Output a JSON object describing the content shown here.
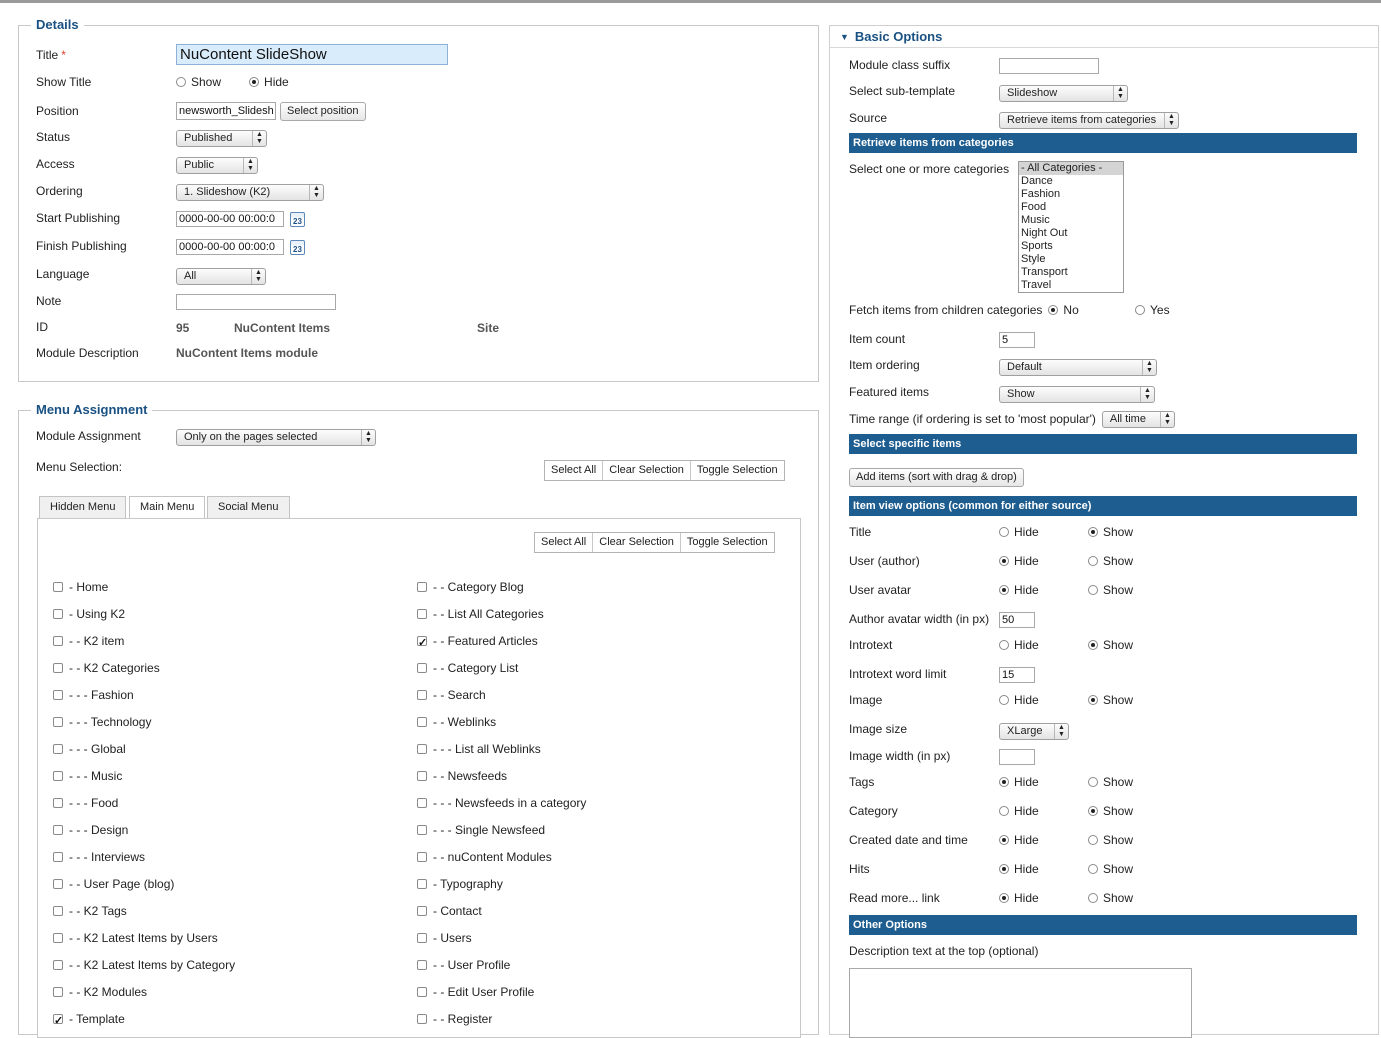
{
  "details": {
    "legend": "Details",
    "title_label": "Title",
    "title_required": "*",
    "title_value": "NuContent SlideShow",
    "show_title_label": "Show Title",
    "show_label": "Show",
    "hide_label": "Hide",
    "position_label": "Position",
    "position_value": "newsworth_Slideshc",
    "select_position": "Select position",
    "status_label": "Status",
    "status_value": "Published",
    "access_label": "Access",
    "access_value": "Public",
    "ordering_label": "Ordering",
    "ordering_value": "1. Slideshow (K2)",
    "start_label": "Start Publishing",
    "start_value": "0000-00-00 00:00:0",
    "finish_label": "Finish Publishing",
    "finish_value": "0000-00-00 00:00:0",
    "calendar_icon_text": "23",
    "language_label": "Language",
    "language_value": "All",
    "note_label": "Note",
    "note_value": "",
    "id_label": "ID",
    "id_value": "95",
    "id_module": "NuContent Items",
    "id_site": "Site",
    "desc_label": "Module Description",
    "desc_value": "NuContent Items module"
  },
  "menu": {
    "legend": "Menu Assignment",
    "assignment_label": "Module Assignment",
    "assignment_value": "Only on the pages selected",
    "selection_label": "Menu Selection:",
    "select_all": "Select All",
    "clear_selection": "Clear Selection",
    "toggle_selection": "Toggle Selection",
    "tabs": [
      "Hidden Menu",
      "Main Menu",
      "Social Menu"
    ],
    "left_items": [
      {
        "label": "- Home",
        "checked": false
      },
      {
        "label": "- Using K2",
        "checked": false
      },
      {
        "label": "- - K2 item",
        "checked": false
      },
      {
        "label": "- - K2 Categories",
        "checked": false
      },
      {
        "label": "- - - Fashion",
        "checked": false
      },
      {
        "label": "- - - Technology",
        "checked": false
      },
      {
        "label": "- - - Global",
        "checked": false
      },
      {
        "label": "- - - Music",
        "checked": false
      },
      {
        "label": "- - - Food",
        "checked": false
      },
      {
        "label": "- - - Design",
        "checked": false
      },
      {
        "label": "- - - Interviews",
        "checked": false
      },
      {
        "label": "- - User Page (blog)",
        "checked": false
      },
      {
        "label": "- - K2 Tags",
        "checked": false
      },
      {
        "label": "- - K2 Latest Items by Users",
        "checked": false
      },
      {
        "label": "- - K2 Latest Items by Category",
        "checked": false
      },
      {
        "label": "- - K2 Modules",
        "checked": false
      },
      {
        "label": "- Template",
        "checked": true
      }
    ],
    "right_items": [
      {
        "label": "- - Category Blog",
        "checked": false
      },
      {
        "label": "- - List All Categories",
        "checked": false
      },
      {
        "label": "- - Featured Articles",
        "checked": true
      },
      {
        "label": "- - Category List",
        "checked": false
      },
      {
        "label": "- - Search",
        "checked": false
      },
      {
        "label": "- - Weblinks",
        "checked": false
      },
      {
        "label": "- - - List all Weblinks",
        "checked": false
      },
      {
        "label": "- - Newsfeeds",
        "checked": false
      },
      {
        "label": "- - - Newsfeeds in a category",
        "checked": false
      },
      {
        "label": "- - - Single Newsfeed",
        "checked": false
      },
      {
        "label": "- - nuContent Modules",
        "checked": false
      },
      {
        "label": "- Typography",
        "checked": false
      },
      {
        "label": "- Contact",
        "checked": false
      },
      {
        "label": "- Users",
        "checked": false
      },
      {
        "label": "- - User Profile",
        "checked": false
      },
      {
        "label": "- - Edit User Profile",
        "checked": false
      },
      {
        "label": "- - Register",
        "checked": false
      }
    ]
  },
  "basic": {
    "title": "Basic Options",
    "suffix_label": "Module class suffix",
    "suffix_value": "",
    "subtemplate_label": "Select sub-template",
    "subtemplate_value": "Slideshow",
    "source_label": "Source",
    "source_value": "Retrieve items from categories",
    "bar_categories": "Retrieve items from categories",
    "categories_label": "Select one or more categories",
    "categories": [
      "- All Categories -",
      "Dance",
      "Fashion",
      "Food",
      "Music",
      "Night Out",
      "Sports",
      "Style",
      "Transport",
      "Travel"
    ],
    "children_label": "Fetch items from children categories",
    "no_label": "No",
    "yes_label": "Yes",
    "count_label": "Item count",
    "count_value": "5",
    "ordering_label": "Item ordering",
    "ordering_value": "Default",
    "featured_label": "Featured items",
    "featured_value": "Show",
    "timerange_label": "Time range (if ordering is set to 'most popular')",
    "timerange_value": "All time",
    "bar_specific": "Select specific items",
    "add_items": "Add items (sort with drag & drop)",
    "bar_view": "Item view options (common for either source)",
    "hide": "Hide",
    "show": "Show",
    "view_rows": [
      {
        "label": "Title",
        "selected": "show"
      },
      {
        "label": "User (author)",
        "selected": "hide"
      },
      {
        "label": "User avatar",
        "selected": "hide"
      }
    ],
    "avatar_width_label": "Author avatar width (in px)",
    "avatar_width_value": "50",
    "introtext_label": "Introtext",
    "introtext_selected": "show",
    "word_limit_label": "Introtext word limit",
    "word_limit_value": "15",
    "image_label": "Image",
    "image_selected": "show",
    "image_size_label": "Image size",
    "image_size_value": "XLarge",
    "image_width_label": "Image width (in px)",
    "image_width_value": "",
    "tail_rows": [
      {
        "label": "Tags",
        "selected": "hide"
      },
      {
        "label": "Category",
        "selected": "show"
      },
      {
        "label": "Created date and time",
        "selected": "hide"
      },
      {
        "label": "Hits",
        "selected": "hide"
      },
      {
        "label": "Read more... link",
        "selected": "hide"
      }
    ],
    "bar_other": "Other Options",
    "desc_top_label": "Description text at the top (optional)"
  }
}
